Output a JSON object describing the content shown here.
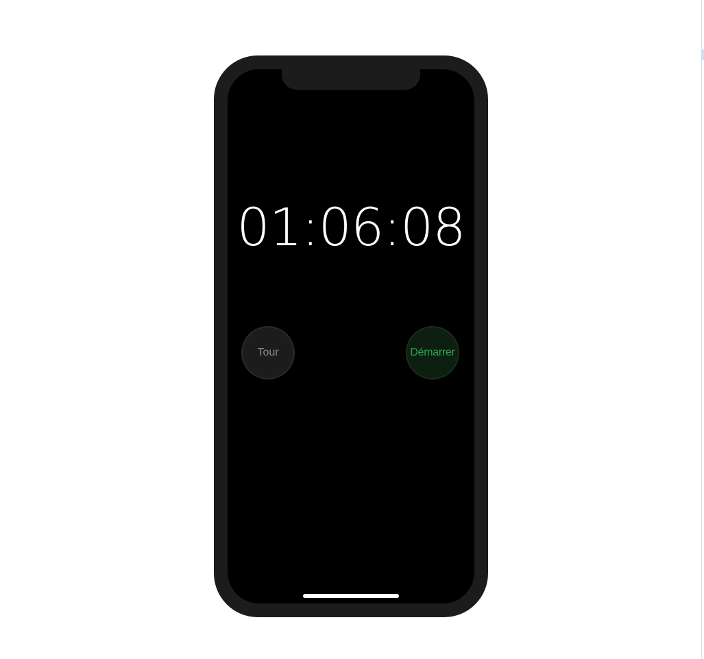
{
  "stopwatch": {
    "time_display": "01:06:08",
    "lap_button_label": "Tour",
    "start_button_label": "Démarrer"
  },
  "colors": {
    "screen_background": "#000000",
    "device_frame": "#1c1c1c",
    "start_accent": "#2fa34a",
    "lap_text": "#8a8a8a"
  }
}
